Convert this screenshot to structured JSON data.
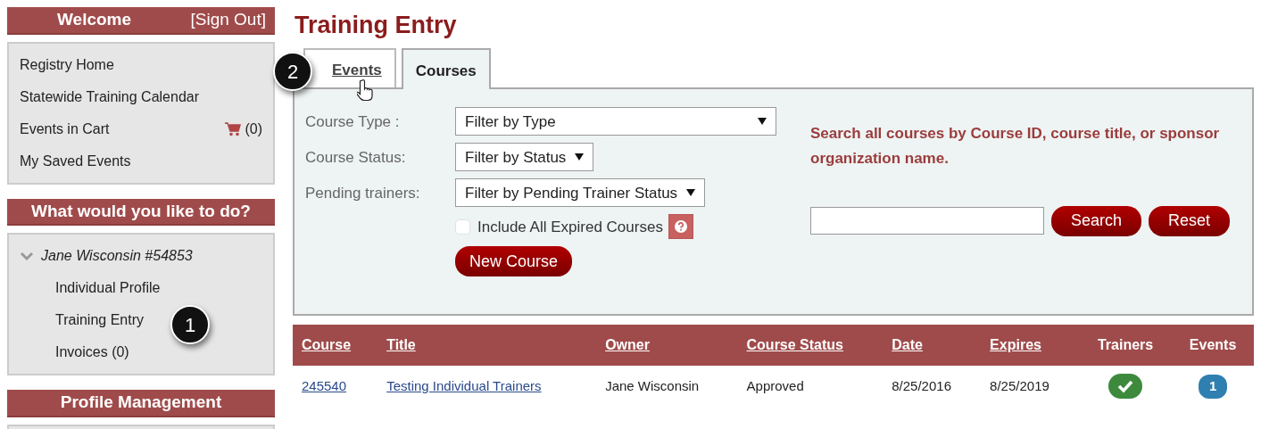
{
  "sidebar": {
    "welcome": {
      "title": "Welcome",
      "sign_out": "[Sign Out]"
    },
    "links": [
      {
        "label": "Registry Home"
      },
      {
        "label": "Statewide Training Calendar"
      },
      {
        "label": "Events in Cart",
        "count": "(0)"
      },
      {
        "label": "My Saved Events"
      }
    ],
    "todo": {
      "title": "What would you like to do?",
      "person": {
        "label": "Jane Wisconsin #54853",
        "expanded": true,
        "children": [
          {
            "label": "Individual Profile"
          },
          {
            "label": "Training Entry",
            "callout": "1"
          },
          {
            "label": "Invoices (0)"
          }
        ]
      }
    },
    "profile": {
      "title": "Profile Management"
    }
  },
  "page_title": "Training Entry",
  "tabs": [
    {
      "label": "Events",
      "selected": false,
      "callout": "2",
      "hovered": true
    },
    {
      "label": "Courses",
      "selected": true
    }
  ],
  "filters": [
    {
      "label": "Course Type :",
      "value": "Filter by Type"
    },
    {
      "label": "Course Status:",
      "value": "Filter by Status"
    },
    {
      "label": "Pending trainers:",
      "value": "Filter by Pending Trainer Status"
    }
  ],
  "expired": {
    "label": "Include All Expired Courses",
    "checked": false
  },
  "new_course": "New Course",
  "search": {
    "hint": "Search all courses by Course ID, course title, or sponsor organization name.",
    "buttons": [
      "Search",
      "Reset"
    ]
  },
  "table": {
    "columns": [
      {
        "label": "Course",
        "sortable": true
      },
      {
        "label": "Title",
        "sortable": true
      },
      {
        "label": "Owner",
        "sortable": true
      },
      {
        "label": "Course Status",
        "sortable": true
      },
      {
        "label": "Date",
        "sortable": true
      },
      {
        "label": "Expires",
        "sortable": true
      },
      {
        "label": "Trainers",
        "sortable": false
      },
      {
        "label": "Events",
        "sortable": false
      }
    ],
    "rows": [
      [
        {
          "kind": "link",
          "text": "245540"
        },
        {
          "kind": "link",
          "text": "Testing Individual Trainers"
        },
        {
          "kind": "text",
          "text": "Jane Wisconsin"
        },
        {
          "kind": "text",
          "text": "Approved"
        },
        {
          "kind": "text",
          "text": "8/25/2016"
        },
        {
          "kind": "text",
          "text": "8/25/2019"
        },
        {
          "kind": "check"
        },
        {
          "kind": "badge",
          "text": "1"
        }
      ]
    ]
  }
}
